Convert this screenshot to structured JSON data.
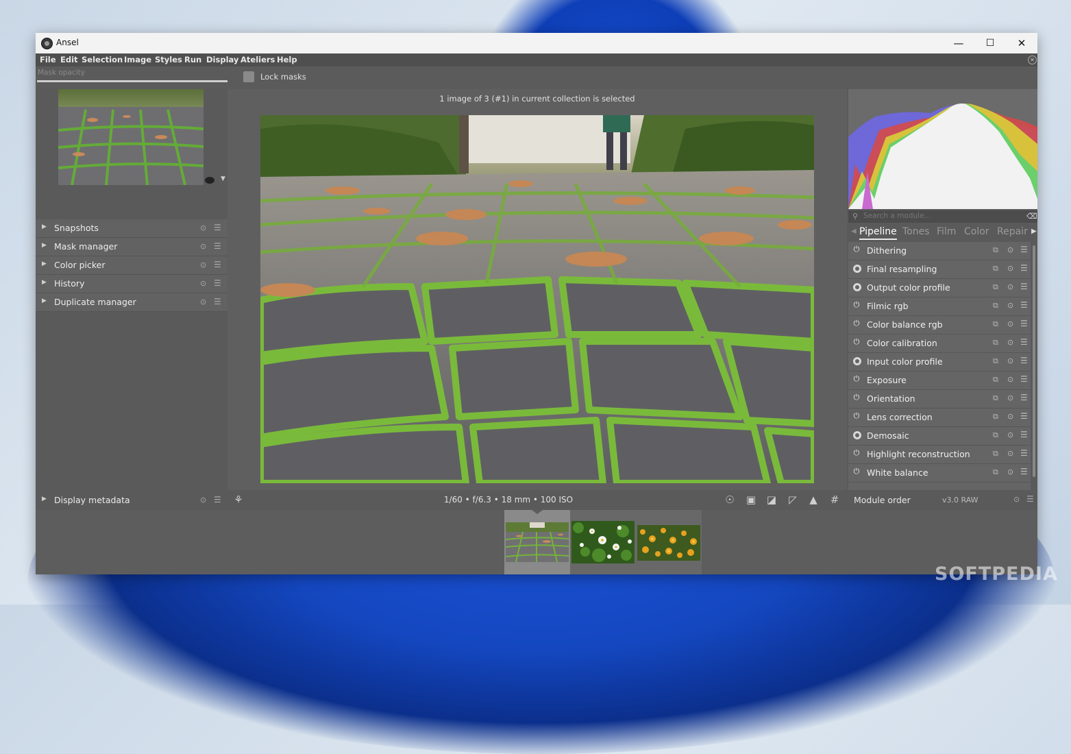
{
  "window": {
    "title": "Ansel",
    "controls": {
      "minimize": "—",
      "maximize": "☐",
      "close": "✕"
    }
  },
  "menu": [
    "File",
    "Edit",
    "Selection",
    "Image",
    "Styles",
    "Run",
    "Display",
    "Ateliers",
    "Help"
  ],
  "toolbar": {
    "mask_opacity_label": "Mask opacity",
    "lock_masks_label": "Lock masks"
  },
  "left_panel": {
    "modules": [
      "Snapshots",
      "Mask manager",
      "Color picker",
      "History",
      "Duplicate manager"
    ],
    "bottom_module": "Display metadata"
  },
  "center": {
    "selection_info": "1 image of 3 (#1) in current collection is selected",
    "exif": "1/60 • f/6.3 • 18 mm • 100 ISO"
  },
  "right_panel": {
    "search_placeholder": "Search a module...",
    "tabs": [
      "Pipeline",
      "Tones",
      "Film",
      "Color",
      "Repair"
    ],
    "active_tab": "Pipeline",
    "modules": [
      {
        "label": "Dithering",
        "enabled": false
      },
      {
        "label": "Final resampling",
        "enabled": true
      },
      {
        "label": "Output color profile",
        "enabled": true
      },
      {
        "label": "Filmic rgb",
        "enabled": false
      },
      {
        "label": "Color balance rgb",
        "enabled": false
      },
      {
        "label": "Color calibration",
        "enabled": false
      },
      {
        "label": "Input color profile",
        "enabled": true
      },
      {
        "label": "Exposure",
        "enabled": false
      },
      {
        "label": "Orientation",
        "enabled": false
      },
      {
        "label": "Lens correction",
        "enabled": false
      },
      {
        "label": "Demosaic",
        "enabled": true
      },
      {
        "label": "Highlight reconstruction",
        "enabled": false
      },
      {
        "label": "White balance",
        "enabled": false
      }
    ],
    "module_order_label": "Module order",
    "module_order_value": "v3.0 RAW"
  },
  "filmstrip": {
    "thumbnails": [
      "cobblestone",
      "white-flowers",
      "yellow-flowers"
    ],
    "selected_index": 0
  },
  "watermark": "SOFTPEDIA",
  "colors": {
    "panel_bg": "#5a5a5a",
    "menu_bg": "#4f4f4f",
    "titlebar_bg": "#f3f3f3",
    "wallpaper_blue": "#1447c0"
  }
}
